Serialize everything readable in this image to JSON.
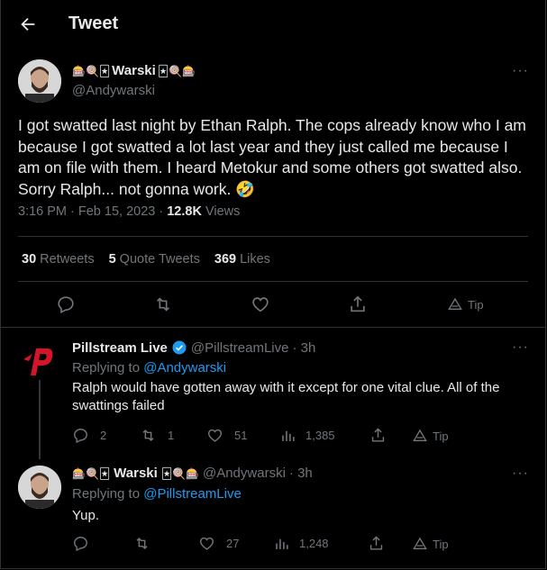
{
  "header": {
    "title": "Tweet"
  },
  "main_tweet": {
    "author": {
      "name_prefix": "🎰🍭🃏",
      "name": "Warski",
      "name_suffix": "🃏🍭🎰",
      "handle": "@Andywarski"
    },
    "text": "I got swatted last night by Ethan Ralph. The cops already know who I am because I got swatted a lot last year and they just called me because I am on file with them. I heard Metokur and some others got swatted also. Sorry Ralph... not gonna work. 🤣",
    "time": "3:16 PM · Feb 15, 2023 · ",
    "views_count": "12.8K",
    "views_label": " Views",
    "stats": {
      "retweets_count": "30",
      "retweets_label": "Retweets",
      "quotes_count": "5",
      "quotes_label": "Quote Tweets",
      "likes_count": "369",
      "likes_label": "Likes"
    },
    "actions": {
      "tip_label": "Tip"
    }
  },
  "replies": [
    {
      "name": "Pillstream Live",
      "handle": "@PillstreamLive",
      "time": "· 3h",
      "replying_prefix": "Replying to ",
      "replying_to": "@Andywarski",
      "text_line1": "Ralph would have gotten away with it except for one vital clue. All of the",
      "text_line2": "swattings failed",
      "replies_count": "2",
      "retweets_count": "1",
      "likes_count": "51",
      "views_count": "1,385",
      "tip_label": "Tip"
    },
    {
      "name_prefix": "🎰🍭🃏",
      "name": "Warski",
      "name_suffix": "🃏🍭🎰",
      "handle": "@Andywarski",
      "time": "· 3h",
      "replying_prefix": "Replying to ",
      "replying_to": "@PillstreamLive",
      "text": "Yup.",
      "replies_count": "",
      "retweets_count": "",
      "likes_count": "27",
      "views_count": "1,248",
      "tip_label": "Tip"
    }
  ],
  "colors": {
    "background": "#000000",
    "text": "#e7e9ea",
    "secondary": "#71767b",
    "link": "#1d9bf0",
    "border": "#2f3336",
    "brand_red": "#d4142a"
  }
}
